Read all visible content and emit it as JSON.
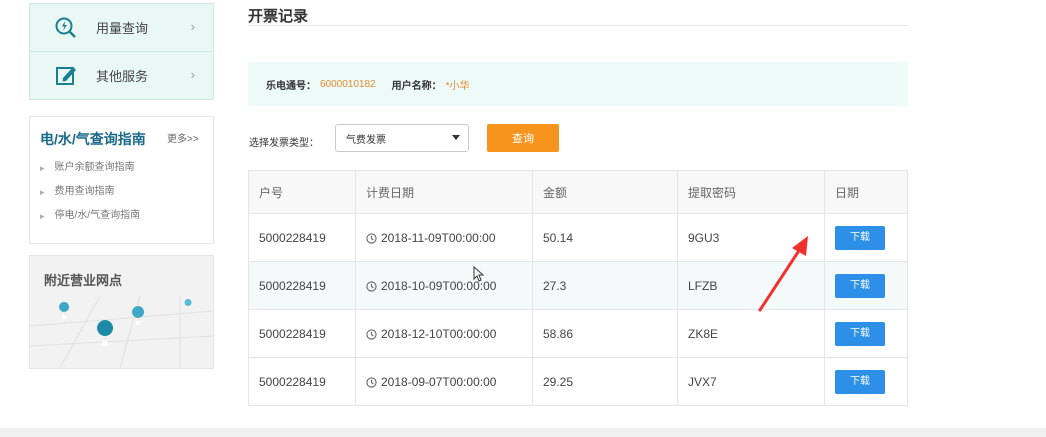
{
  "sidebar": {
    "menu": [
      {
        "label": "用量查询",
        "icon": "search-icon"
      },
      {
        "label": "其他服务",
        "icon": "edit-icon"
      }
    ],
    "chevron": "›",
    "guide": {
      "title": "电/水/气查询指南",
      "more": "更多>>",
      "items": [
        "账户余额查询指南",
        "费用查询指南",
        "停电/水/气查询指南"
      ]
    },
    "nearby": {
      "title": "附近营业网点"
    }
  },
  "main": {
    "title": "开票记录",
    "info": {
      "account_label": "乐电通号：",
      "account_value": "6000010182",
      "user_label": "用户名称：",
      "user_value": "*小华"
    },
    "filter": {
      "label": "选择发票类型：",
      "selected": "气费发票",
      "query_button": "查询"
    },
    "table": {
      "headers": [
        "户号",
        "计费日期",
        "金额",
        "提取密码",
        "日期"
      ],
      "rows": [
        {
          "account": "5000228419",
          "date": "2018-11-09T00:00:00",
          "amount": "50.14",
          "code": "9GU3",
          "action": "下载"
        },
        {
          "account": "5000228419",
          "date": "2018-10-09T00:00:00",
          "amount": "27.3",
          "code": "LFZB",
          "action": "下载"
        },
        {
          "account": "5000228419",
          "date": "2018-12-10T00:00:00",
          "amount": "58.86",
          "code": "ZK8E",
          "action": "下载"
        },
        {
          "account": "5000228419",
          "date": "2018-09-07T00:00:00",
          "amount": "29.25",
          "code": "JVX7",
          "action": "下载"
        }
      ]
    }
  },
  "colors": {
    "accent_orange": "#f7941d",
    "download_blue": "#2d8fe8",
    "teal_title": "#1b6a8a",
    "annotation_red": "#f0302a"
  }
}
